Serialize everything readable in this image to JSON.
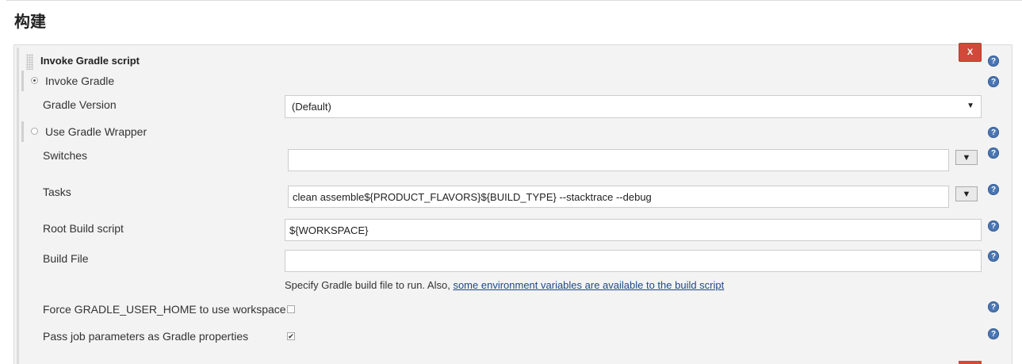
{
  "section": {
    "title": "构建"
  },
  "step": {
    "title": "Invoke Gradle script",
    "delete_label": "X",
    "help_label": "?",
    "options": {
      "invoke_gradle": {
        "label": "Invoke Gradle",
        "selected": true
      },
      "use_wrapper": {
        "label": "Use Gradle Wrapper",
        "selected": false
      }
    },
    "gradle_version": {
      "label": "Gradle Version",
      "value": "(Default)",
      "arrow": "▼"
    },
    "switches": {
      "label": "Switches",
      "value": "",
      "expand_label": "▼"
    },
    "tasks": {
      "label": "Tasks",
      "value": "clean assemble${PRODUCT_FLAVORS}${BUILD_TYPE} --stacktrace --debug",
      "expand_label": "▼"
    },
    "root_build_script": {
      "label": "Root Build script",
      "value": "${WORKSPACE}"
    },
    "build_file": {
      "label": "Build File",
      "value": "",
      "description": "Specify Gradle build file to run. Also, ",
      "description_link": "some environment variables are available to the build script"
    },
    "force_home": {
      "label": "Force GRADLE_USER_HOME to use workspace",
      "checked": false
    },
    "pass_params": {
      "label": "Pass job parameters as Gradle properties",
      "checked": true,
      "check_mark": "✔"
    }
  },
  "colors": {
    "delete": "#d24939",
    "help": "#4a76b3",
    "link": "#204a87"
  }
}
